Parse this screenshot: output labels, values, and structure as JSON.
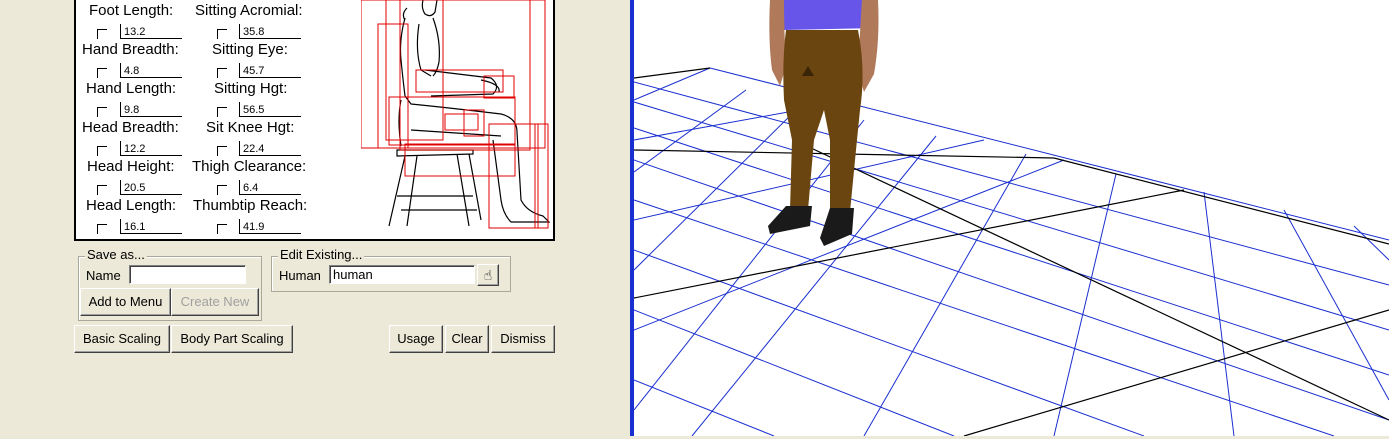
{
  "measurements": [
    {
      "label": "Foot Length:",
      "value": "13.2"
    },
    {
      "label": "Hand Breadth:",
      "value": "4.8"
    },
    {
      "label": "Hand Length:",
      "value": "9.8"
    },
    {
      "label": "Head Breadth:",
      "value": "12.2"
    },
    {
      "label": "Head Height:",
      "value": "20.5"
    },
    {
      "label": "Head Length:",
      "value": "16.1"
    },
    {
      "label": "Sitting Acromial:",
      "value": "35.8"
    },
    {
      "label": "Sitting Eye:",
      "value": "45.7"
    },
    {
      "label": "Sitting Hgt:",
      "value": "56.5"
    },
    {
      "label": "Sit Knee Hgt:",
      "value": "22.4"
    },
    {
      "label": "Thigh Clearance:",
      "value": "6.4"
    },
    {
      "label": "Thumbtip Reach:",
      "value": "41.9"
    }
  ],
  "save_as": {
    "legend": "Save as...",
    "name_label": "Name",
    "name_value": "",
    "add_button": "Add to Menu",
    "create_button": "Create New"
  },
  "edit_existing": {
    "legend": "Edit Existing...",
    "label": "Human",
    "value": "human"
  },
  "buttons": {
    "basic_scaling": "Basic Scaling",
    "body_part_scaling": "Body Part Scaling",
    "usage": "Usage",
    "clear": "Clear",
    "dismiss": "Dismiss"
  },
  "colors": {
    "grid_line": "#1a2fd0",
    "horizon_line": "#000000",
    "shirt": "#6655e8",
    "pants": "#6b4510",
    "viewport_border": "#1a2fd0"
  },
  "icons": {
    "pick": "hand-pointer-icon"
  }
}
